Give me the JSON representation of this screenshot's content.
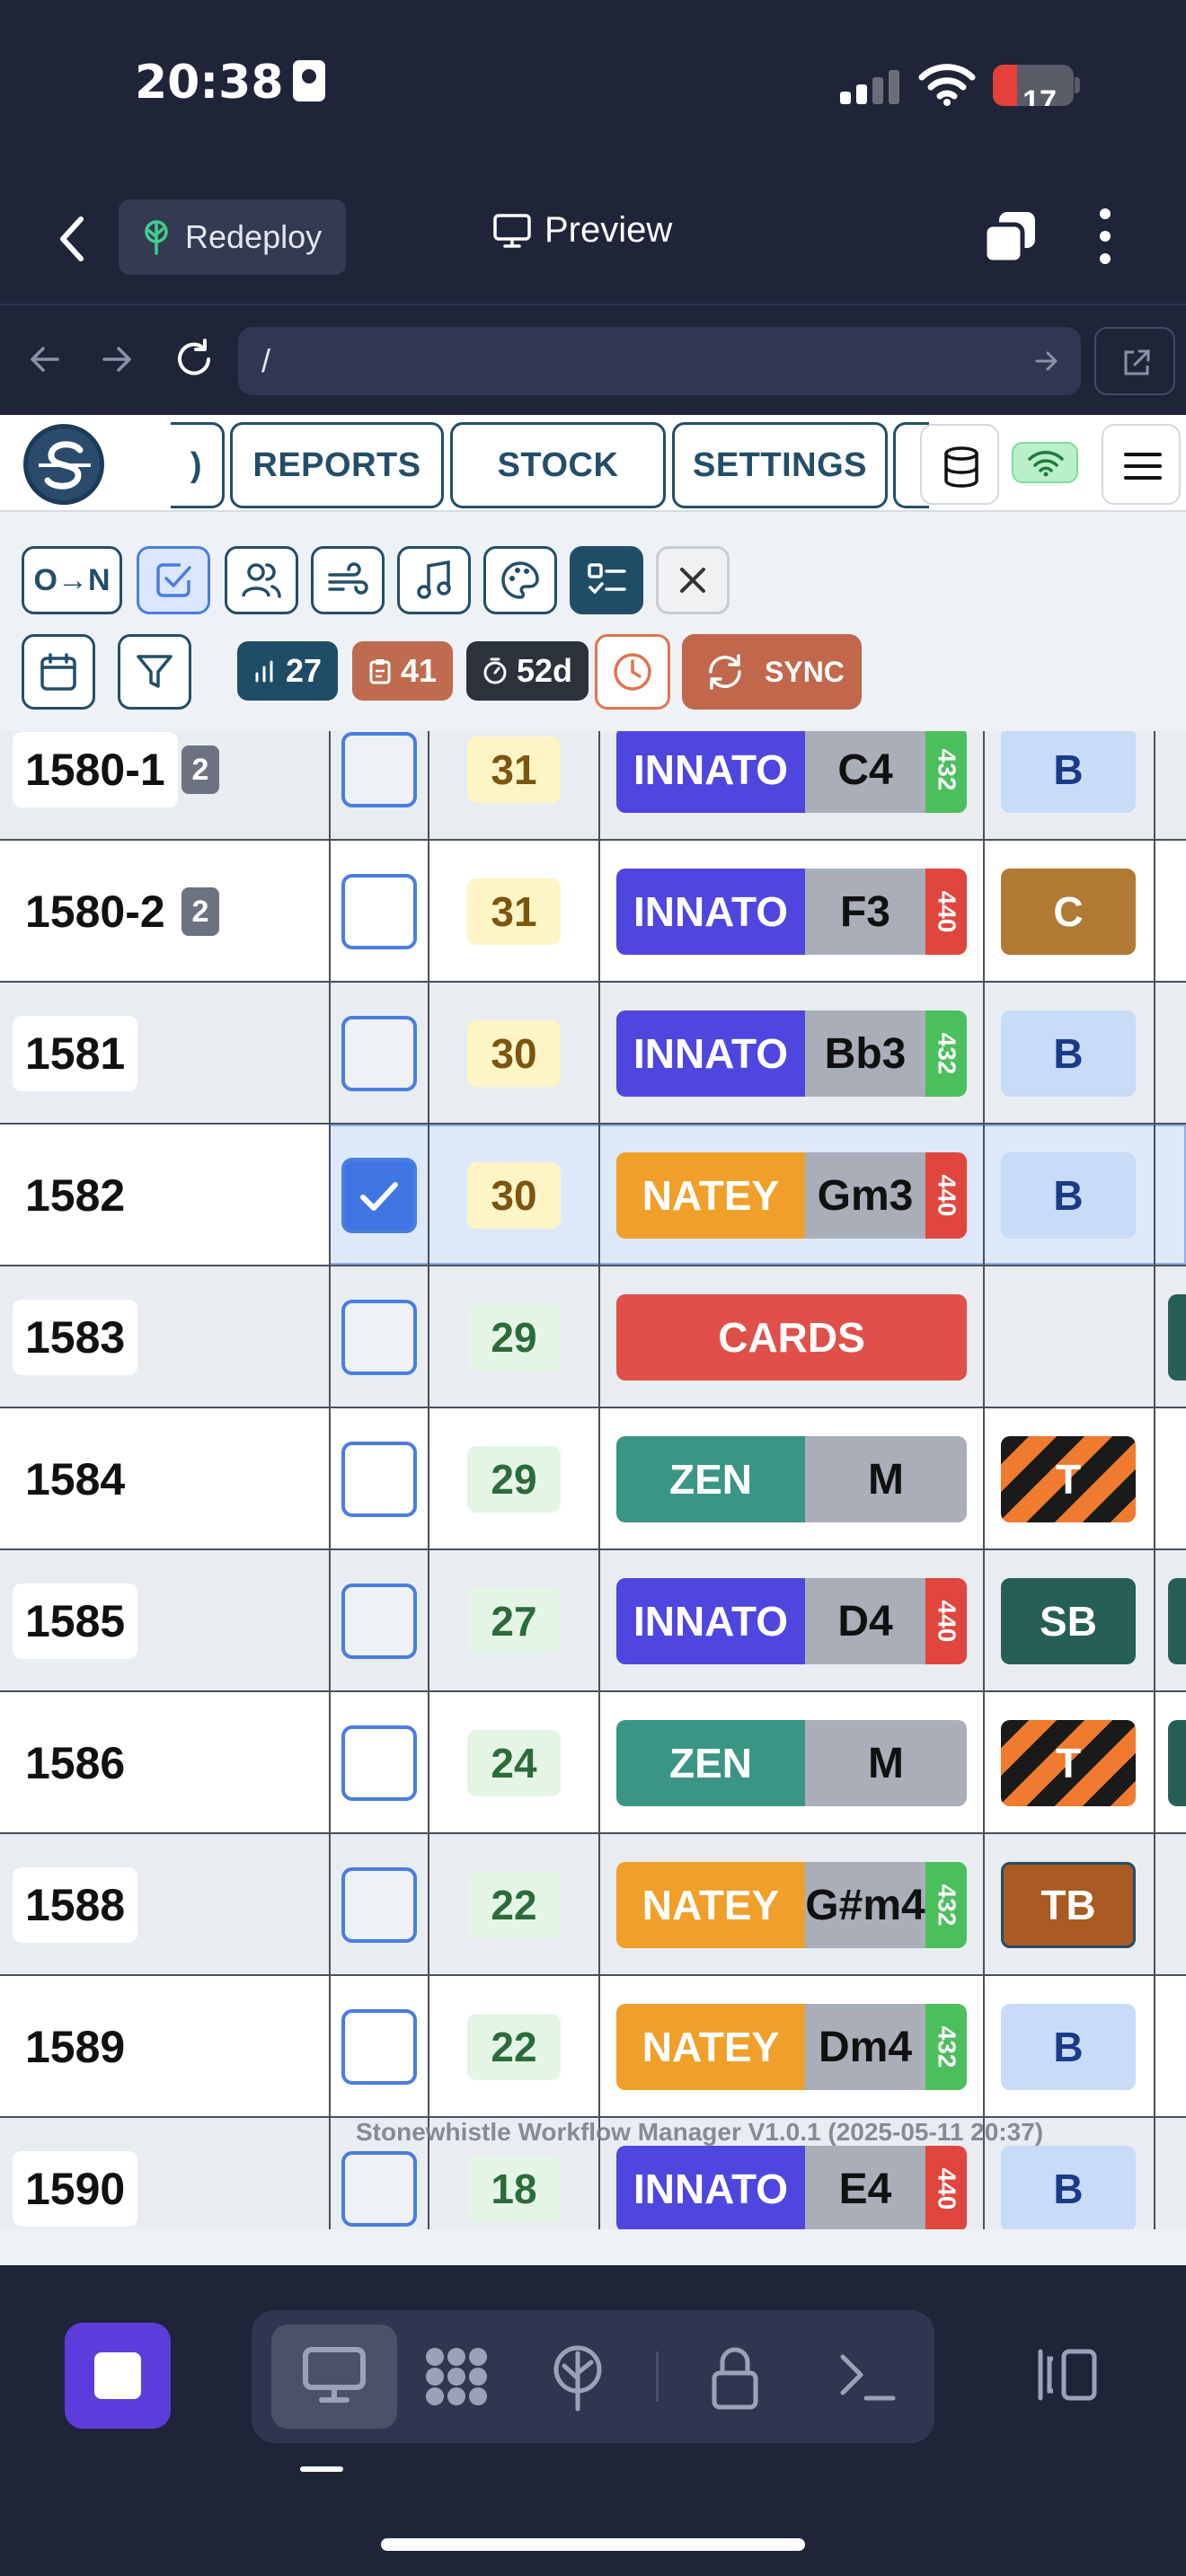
{
  "status_bar": {
    "time": "20:38",
    "battery": "17"
  },
  "topnav": {
    "redeploy_label": "Redeploy",
    "preview_label": "Preview"
  },
  "urlbar": {
    "url": "/"
  },
  "app_tabs": [
    {
      "label": ")"
    },
    {
      "label": "REPORTS"
    },
    {
      "label": "STOCK"
    },
    {
      "label": "SETTINGS"
    }
  ],
  "toolbar": {
    "sort_label": "O→N",
    "stats": {
      "bars": "27",
      "clipboard": "41",
      "timer": "52d"
    },
    "sync_label": "SYNC"
  },
  "rows": [
    {
      "id": "1580-1",
      "badge": "2",
      "checked": false,
      "count": "31",
      "count_color": "yellow",
      "brand": "INNATO",
      "brand_color": "#4f46e0",
      "note": "C4",
      "tuning": "432",
      "tuning_color": "#4bbf5c",
      "type": "B",
      "type_style": "b"
    },
    {
      "id": "1580-2",
      "badge": "2",
      "checked": false,
      "count": "31",
      "count_color": "yellow",
      "brand": "INNATO",
      "brand_color": "#4f46e0",
      "note": "F3",
      "tuning": "440",
      "tuning_color": "#e0453e",
      "type": "C",
      "type_style": "c"
    },
    {
      "id": "1581",
      "badge": "",
      "checked": false,
      "count": "30",
      "count_color": "yellow",
      "brand": "INNATO",
      "brand_color": "#4f46e0",
      "note": "Bb3",
      "tuning": "432",
      "tuning_color": "#4bbf5c",
      "type": "B",
      "type_style": "b"
    },
    {
      "id": "1582",
      "badge": "",
      "checked": true,
      "count": "30",
      "count_color": "yellow",
      "brand": "NATEY",
      "brand_color": "#f0a02a",
      "note": "Gm3",
      "tuning": "440",
      "tuning_color": "#e0453e",
      "type": "B",
      "type_style": "b"
    },
    {
      "id": "1583",
      "badge": "",
      "checked": false,
      "count": "29",
      "count_color": "green",
      "brand": "CARDS",
      "brand_color": "#e0504a",
      "note": "",
      "tuning": "",
      "tuning_color": "",
      "type": "",
      "type_style": ""
    },
    {
      "id": "1584",
      "badge": "",
      "checked": false,
      "count": "29",
      "count_color": "green",
      "brand": "ZEN",
      "brand_color": "#3b9585",
      "note": "M",
      "tuning": "",
      "tuning_color": "",
      "type": "T",
      "type_style": "t"
    },
    {
      "id": "1585",
      "badge": "",
      "checked": false,
      "count": "27",
      "count_color": "green",
      "brand": "INNATO",
      "brand_color": "#4f46e0",
      "note": "D4",
      "tuning": "440",
      "tuning_color": "#e0453e",
      "type": "SB",
      "type_style": "sb"
    },
    {
      "id": "1586",
      "badge": "",
      "checked": false,
      "count": "24",
      "count_color": "green",
      "brand": "ZEN",
      "brand_color": "#3b9585",
      "note": "M",
      "tuning": "",
      "tuning_color": "",
      "type": "T",
      "type_style": "t"
    },
    {
      "id": "1588",
      "badge": "",
      "checked": false,
      "count": "22",
      "count_color": "green",
      "brand": "NATEY",
      "brand_color": "#f0a02a",
      "note": "G#m4",
      "tuning": "432",
      "tuning_color": "#4bbf5c",
      "type": "TB",
      "type_style": "tb"
    },
    {
      "id": "1589",
      "badge": "",
      "checked": false,
      "count": "22",
      "count_color": "green",
      "brand": "NATEY",
      "brand_color": "#f0a02a",
      "note": "Dm4",
      "tuning": "432",
      "tuning_color": "#4bbf5c",
      "type": "B",
      "type_style": "b"
    },
    {
      "id": "1590",
      "badge": "",
      "checked": false,
      "count": "18",
      "count_color": "green",
      "brand": "INNATO",
      "brand_color": "#4f46e0",
      "note": "E4",
      "tuning": "440",
      "tuning_color": "#e0453e",
      "type": "B",
      "type_style": "b"
    }
  ],
  "footer": {
    "version_text": "Stonewhistle Workflow Manager V1.0.1 (2025-05-11 20:37)"
  },
  "icons": {
    "status": [
      "contact-card-icon",
      "cellular-signal-icon",
      "wifi-icon",
      "battery-icon"
    ],
    "topnav": [
      "chevron-left-icon",
      "tree-icon",
      "monitor-icon",
      "copy-window-icon",
      "more-vertical-icon"
    ],
    "urlbar": [
      "arrow-left-icon",
      "arrow-right-icon",
      "refresh-icon",
      "go-arrow-icon",
      "external-link-icon"
    ],
    "header": [
      "stonewhistle-logo",
      "database-icon",
      "wifi-status-icon",
      "hamburger-menu-icon"
    ],
    "toolbar": [
      "checkbox-icon",
      "users-icon",
      "wind-icon",
      "music-note-icon",
      "palette-icon",
      "checklist-icon",
      "close-icon",
      "calendar-icon",
      "filter-icon",
      "bar-chart-icon",
      "clipboard-icon",
      "timer-icon",
      "clock-icon",
      "sync-icon"
    ],
    "dock": [
      "stop-icon",
      "desktop-icon",
      "apps-grid-icon",
      "deploy-tree-icon",
      "lock-icon",
      "terminal-icon",
      "sidebar-toggle-icon"
    ]
  },
  "colors": {
    "accent": "#234e68",
    "selection": "#3f76e2",
    "sync": "#c0674c"
  }
}
